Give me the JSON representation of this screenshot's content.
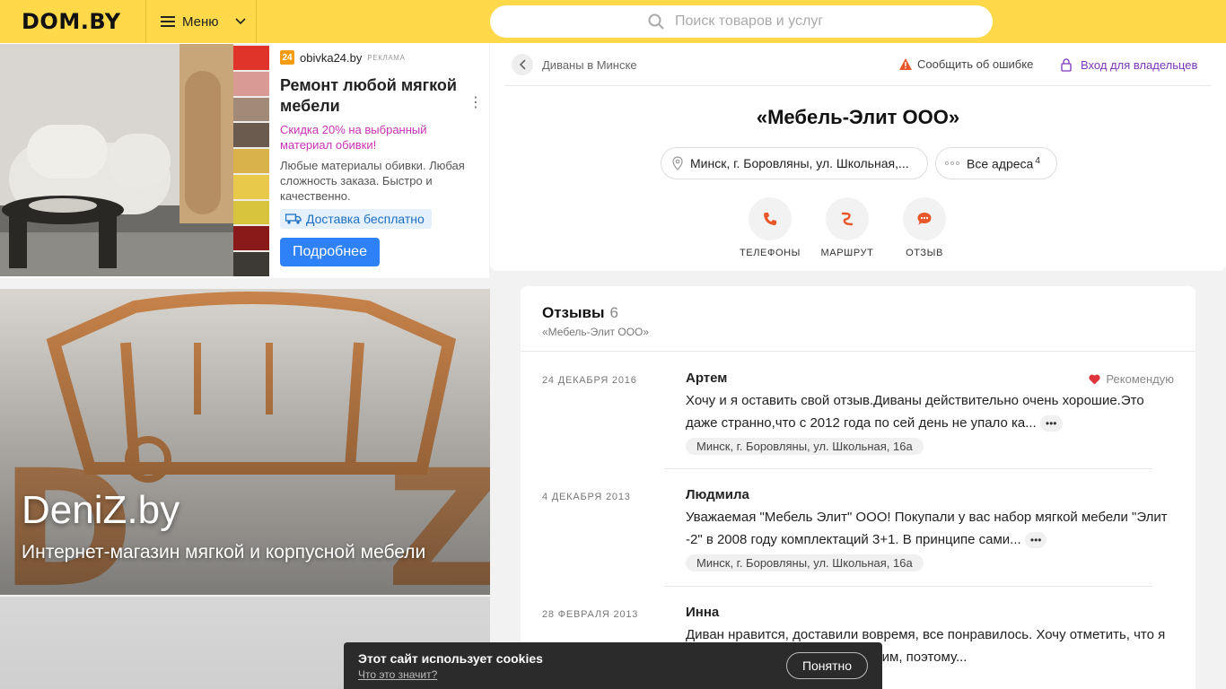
{
  "header": {
    "logo": "DOM.BY",
    "menu_label": "Меню",
    "search_placeholder": "Поиск товаров и услуг"
  },
  "ad": {
    "source_badge": "24",
    "source": "obivka24.by",
    "tag": "РЕКЛАМА",
    "title": "Ремонт любой мягкой мебели",
    "sale": "Скидка 20% на выбранный материал обивки!",
    "description": "Любые материалы обивки. Любая сложность заказа. Быстро и качественно.",
    "delivery": "Доставка бесплатно",
    "cta": "Подробнее",
    "swatches": [
      "#e0342a",
      "#d99a94",
      "#a28a78",
      "#6b5a4e",
      "#d9b24a",
      "#e8c94a",
      "#d8c43c",
      "#8a1a1a",
      "#3d3a36"
    ]
  },
  "banner": {
    "title": "DeniZ.by",
    "subtitle": "Интернет-магазин мягкой и корпусной мебели"
  },
  "company": {
    "breadcrumb": "Диваны в Минске",
    "report": "Сообщить об ошибке",
    "owners": "Вход для владельцев",
    "title": "«Мебель-Элит ООО»",
    "address": "Минск, г. Боровляны, ул. Школьная,...",
    "all_addresses": "Все адреса",
    "all_addresses_count": "4",
    "actions": {
      "phones": "ТЕЛЕФОНЫ",
      "route": "МАРШРУТ",
      "review": "ОТЗЫВ"
    }
  },
  "reviews": {
    "title": "Отзывы",
    "count": "6",
    "subtitle": "«Мебель-Элит ООО»",
    "items": [
      {
        "date": "24 ДЕКАБРЯ 2016",
        "author": "Артем",
        "recommend": "Рекомендую",
        "text": "Хочу и я оставить свой отзыв.Диваны действительно очень хорошие.Это даже странно,что с 2012 года по сей день не упало ка...",
        "more": "•••",
        "address": "Минск, г. Боровляны, ул. Школьная, 16а"
      },
      {
        "date": "4 ДЕКАБРЯ 2013",
        "author": "Людмила",
        "text": "Уважаемая \"Мебель Элит\" ООО! Покупали у вас набор мягкой мебели \"Элит -2\" в 2008 году комплектаций 3+1. В принципе сами...",
        "more": "•••",
        "address": "Минск, г. Боровляны, ул. Школьная, 16а"
      },
      {
        "date": "28 ФЕВРАЛЯ 2013",
        "author": "Инна",
        "text": "Диван нравится, доставили вовремя, все понравилось. Хочу отметить, что я в первый раз столкнулась с таким, поэтому..."
      }
    ]
  },
  "cookie": {
    "title": "Этот сайт использует cookies",
    "link": "Что это значит?",
    "button": "Понятно"
  },
  "colors": {
    "header_yellow": "#ffd94a",
    "accent_orange": "#e8572a",
    "owners_purple": "#7b35b8",
    "cta_blue": "#2f81f7",
    "heart_red": "#e0343c"
  }
}
